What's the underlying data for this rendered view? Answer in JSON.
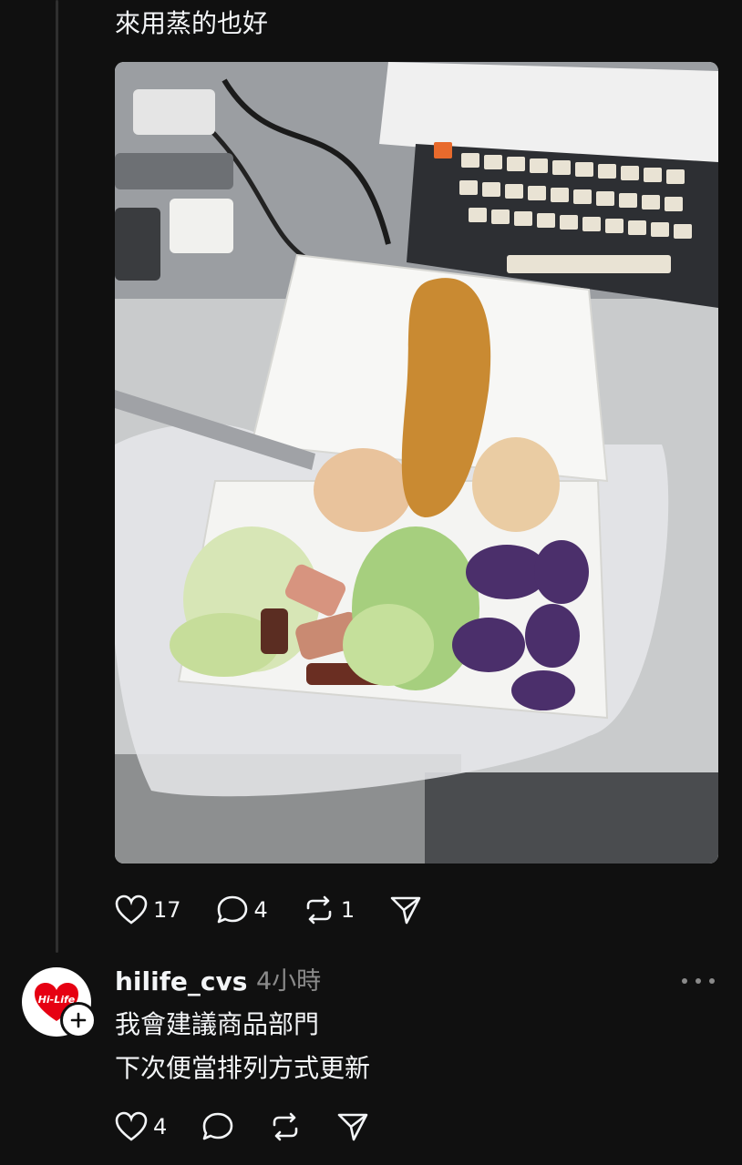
{
  "post": {
    "text": "來用蒸的也好",
    "image_alt": "Bento box with steamed vegetables, eggs, eggplant and a sweet potato",
    "likes": "17",
    "comments": "4",
    "reposts": "1"
  },
  "reply": {
    "username": "hilife_cvs",
    "time": "4小時",
    "logo_text": "Hi-Life",
    "lines": [
      "我會建議商品部門",
      "下次便當排列方式更新"
    ],
    "likes": "4"
  },
  "colors": {
    "background": "#101010",
    "text": "#f3f5f7",
    "muted": "#8a8a8a",
    "brand_red": "#e60012"
  }
}
